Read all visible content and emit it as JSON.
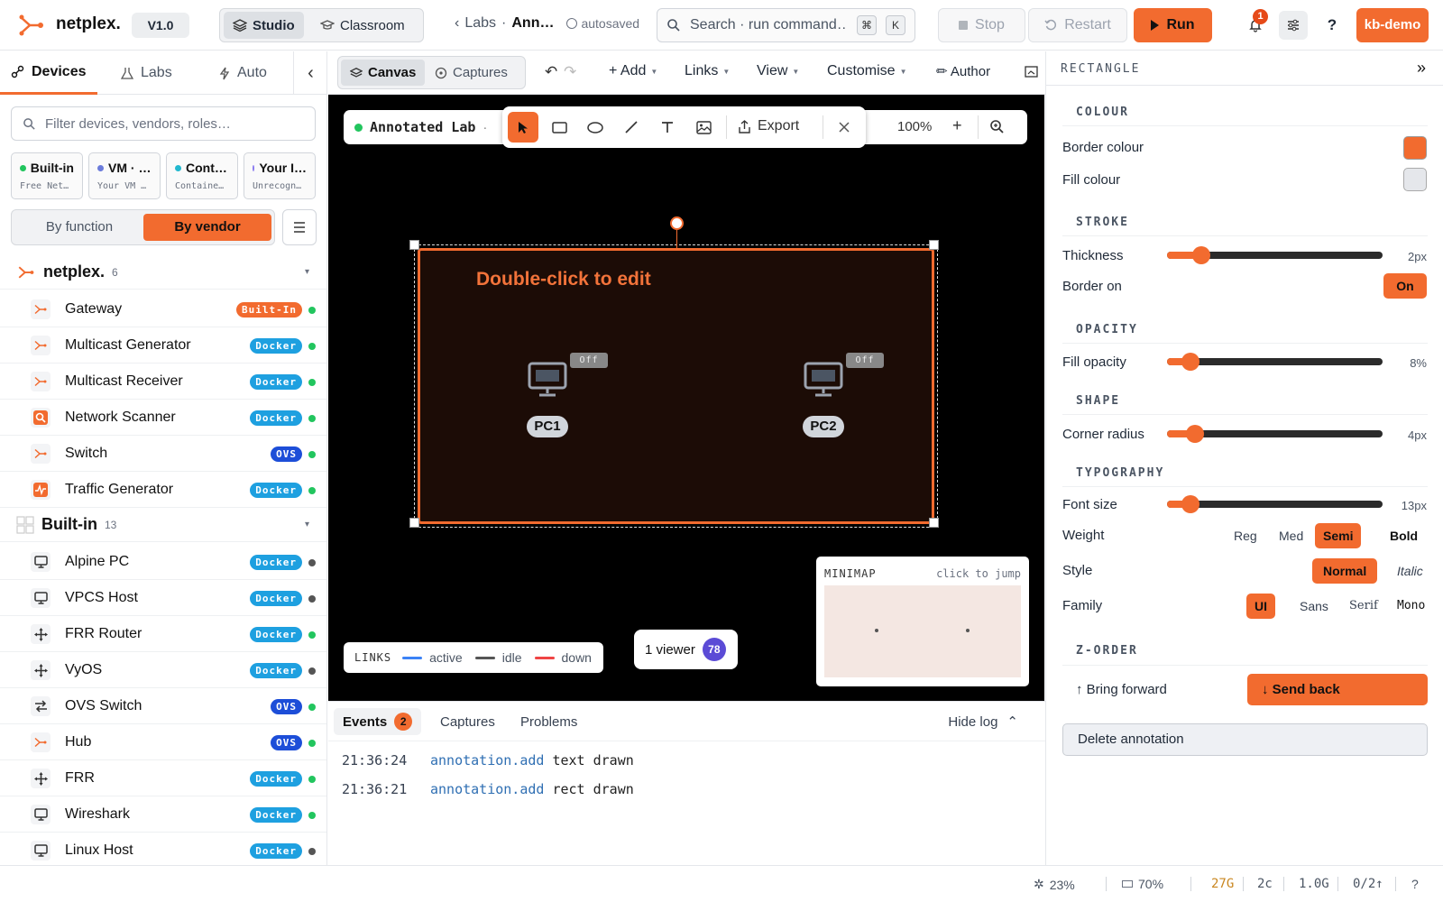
{
  "app": {
    "name": "netplex.",
    "version": "V1.0",
    "user": "kb-demo"
  },
  "mode_tabs": [
    {
      "label": "Studio",
      "active": true
    },
    {
      "label": "Classroom",
      "active": false
    }
  ],
  "breadcrumb": {
    "back": "Labs",
    "sep": "·",
    "current": "Ann…",
    "status": "autosaved"
  },
  "search": {
    "placeholder": "Search · run command…",
    "key1": "⌘",
    "key2": "K"
  },
  "run_controls": {
    "stop": "Stop",
    "restart": "Restart",
    "run": "Run"
  },
  "notifications": {
    "count": "1"
  },
  "help": "?",
  "left": {
    "tabs": [
      {
        "label": "Devices",
        "active": true
      },
      {
        "label": "Labs",
        "active": false
      },
      {
        "label": "Auto",
        "active": false
      }
    ],
    "collapse": "‹",
    "filter_placeholder": "Filter devices, vendors, roles…",
    "chips": [
      {
        "title": "Built-in",
        "sub": "Free Net…",
        "color": "#22c55e"
      },
      {
        "title": "VM · …",
        "sub": "Your VM …",
        "color": "#6b7bdb"
      },
      {
        "title": "Cont…",
        "sub": "Containe…",
        "color": "#22b8cf"
      },
      {
        "title": "Your I…",
        "sub": "Unrecogn…",
        "color": "#8b7cf0"
      }
    ],
    "group_by": [
      {
        "label": "By function",
        "active": false
      },
      {
        "label": "By vendor",
        "active": true
      }
    ],
    "groups": [
      {
        "name": "netplex.",
        "count": "6",
        "caret": "▾",
        "devices": [
          {
            "name": "Gateway",
            "badge": "Built-In",
            "badge_color": "#f26b2f",
            "icon": "netplex-icon",
            "status_color": "#22c55e"
          },
          {
            "name": "Multicast Generator",
            "badge": "Docker",
            "badge_color": "#1ea0e0",
            "icon": "netplex-icon",
            "status_color": "#22c55e"
          },
          {
            "name": "Multicast Receiver",
            "badge": "Docker",
            "badge_color": "#1ea0e0",
            "icon": "netplex-icon",
            "status_color": "#22c55e"
          },
          {
            "name": "Network Scanner",
            "badge": "Docker",
            "badge_color": "#1ea0e0",
            "icon": "scanner-icon",
            "status_color": "#22c55e"
          },
          {
            "name": "Switch",
            "badge": "OVS",
            "badge_color": "#1d4ed8",
            "icon": "netplex-icon",
            "status_color": "#22c55e"
          },
          {
            "name": "Traffic Generator",
            "badge": "Docker",
            "badge_color": "#1ea0e0",
            "icon": "traffic-icon",
            "status_color": "#22c55e"
          }
        ]
      },
      {
        "name": "Built-in",
        "count": "13",
        "caret": "▾",
        "devices": [
          {
            "name": "Alpine PC",
            "badge": "Docker",
            "badge_color": "#1ea0e0",
            "icon": "monitor-icon",
            "status_color": "#555"
          },
          {
            "name": "VPCS Host",
            "badge": "Docker",
            "badge_color": "#1ea0e0",
            "icon": "monitor-icon",
            "status_color": "#555"
          },
          {
            "name": "FRR Router",
            "badge": "Docker",
            "badge_color": "#1ea0e0",
            "icon": "router-icon",
            "status_color": "#22c55e"
          },
          {
            "name": "VyOS",
            "badge": "Docker",
            "badge_color": "#1ea0e0",
            "icon": "router-icon",
            "status_color": "#555"
          },
          {
            "name": "OVS Switch",
            "badge": "OVS",
            "badge_color": "#1d4ed8",
            "icon": "switch-icon",
            "status_color": "#22c55e"
          },
          {
            "name": "Hub",
            "badge": "OVS",
            "badge_color": "#1d4ed8",
            "icon": "netplex-icon",
            "status_color": "#22c55e"
          },
          {
            "name": "FRR",
            "badge": "Docker",
            "badge_color": "#1ea0e0",
            "icon": "router-icon",
            "status_color": "#22c55e"
          },
          {
            "name": "Wireshark",
            "badge": "Docker",
            "badge_color": "#1ea0e0",
            "icon": "monitor-icon",
            "status_color": "#22c55e"
          },
          {
            "name": "Linux Host",
            "badge": "Docker",
            "badge_color": "#1ea0e0",
            "icon": "monitor-icon",
            "status_color": "#555"
          }
        ]
      }
    ]
  },
  "canvas_toolbar": {
    "tabs": [
      {
        "label": "Canvas",
        "active": true
      },
      {
        "label": "Captures",
        "active": false
      }
    ],
    "undo": "↶",
    "redo": "↷",
    "menus": [
      "+ Add",
      "Links",
      "View",
      "Customise"
    ],
    "author": "✏ Author"
  },
  "canvas": {
    "lab_title": "Annotated Lab",
    "lab_sep": "·",
    "export": "Export",
    "zoom": "100%",
    "zoom_in": "+",
    "annotation_text": "Double-click to edit",
    "nodes": [
      {
        "label": "PC1",
        "state": "Off"
      },
      {
        "label": "PC2",
        "state": "Off"
      }
    ],
    "links_legend": {
      "title": "LINKS",
      "items": [
        {
          "label": "active",
          "color": "#3b82f6"
        },
        {
          "label": "idle",
          "color": "#555"
        },
        {
          "label": "down",
          "color": "#ef4444"
        }
      ]
    },
    "viewers": {
      "label": "1 viewer",
      "count": "78"
    },
    "minimap": {
      "title": "MINIMAP",
      "hint": "click to jump"
    }
  },
  "log": {
    "tabs": [
      {
        "label": "Events",
        "count": "2",
        "active": true
      },
      {
        "label": "Captures",
        "active": false
      },
      {
        "label": "Problems",
        "active": false
      }
    ],
    "hide": "Hide log",
    "hide_caret": "⌃",
    "rows": [
      {
        "time": "21:36:24",
        "event": "annotation.add",
        "detail": "text drawn"
      },
      {
        "time": "21:36:21",
        "event": "annotation.add",
        "detail": "rect drawn"
      }
    ]
  },
  "inspector": {
    "title": "RECTANGLE",
    "collapse": "»",
    "colour": {
      "section": "COLOUR",
      "border_label": "Border colour",
      "border_value": "#f26b2f",
      "fill_label": "Fill colour",
      "fill_value": "#e5e7eb"
    },
    "stroke": {
      "section": "STROKE",
      "thickness_label": "Thickness",
      "thickness": "2px",
      "thickness_pct": 16,
      "border_on_label": "Border on",
      "border_on": "On"
    },
    "opacity": {
      "section": "OPACITY",
      "label": "Fill opacity",
      "value": "8%",
      "pct": 11
    },
    "shape": {
      "section": "SHAPE",
      "label": "Corner radius",
      "value": "4px",
      "pct": 13
    },
    "typography": {
      "section": "TYPOGRAPHY",
      "size_label": "Font size",
      "size": "13px",
      "size_pct": 11,
      "weight_label": "Weight",
      "weights": [
        {
          "label": "Reg",
          "active": false
        },
        {
          "label": "Med",
          "active": false
        },
        {
          "label": "Semi",
          "active": true
        },
        {
          "label": "Bold",
          "active": false
        }
      ],
      "style_label": "Style",
      "styles": [
        {
          "label": "Normal",
          "active": true
        },
        {
          "label": "Italic",
          "active": false
        }
      ],
      "family_label": "Family",
      "families": [
        {
          "label": "UI",
          "active": true
        },
        {
          "label": "Sans",
          "active": false
        },
        {
          "label": "Serif",
          "active": false
        },
        {
          "label": "Mono",
          "active": false
        }
      ]
    },
    "zorder": {
      "section": "Z-ORDER",
      "forward": "↑ Bring forward",
      "back": "↓ Send back"
    },
    "delete": "Delete annotation"
  },
  "status": {
    "cpu": "23%",
    "mem": "70%",
    "disk": "27G",
    "cores": "2c",
    "net": "1.0G",
    "io": "0/2↑",
    "help": "?"
  }
}
